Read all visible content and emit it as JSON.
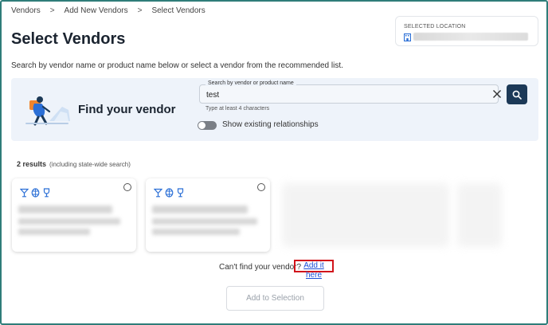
{
  "breadcrumb": {
    "items": [
      "Vendors",
      "Add New Vendors",
      "Select Vendors"
    ],
    "separator": ">"
  },
  "page": {
    "title": "Select Vendors",
    "instructions": "Search by vendor name or product name below or select a vendor from the recommended list."
  },
  "location": {
    "label": "SELECTED LOCATION",
    "icon": "building-icon"
  },
  "search_panel": {
    "title": "Find your vendor",
    "field_label": "Search by vendor or product name",
    "value": "test",
    "hint": "Type at least 4 characters",
    "toggle_label": "Show existing relationships",
    "toggle_on": false
  },
  "results": {
    "count_text": "2 results",
    "scope_text": "(including state-wide search)",
    "cards": [
      {
        "icons": [
          "cocktail-glass-icon",
          "beer-barrel-icon",
          "wine-glass-icon"
        ],
        "selected": false
      },
      {
        "icons": [
          "cocktail-glass-icon",
          "beer-barrel-icon",
          "wine-glass-icon"
        ],
        "selected": false
      }
    ]
  },
  "footer": {
    "cant_find_text": "Can't find your vendor?",
    "add_link_text": "Add it here",
    "add_button_label": "Add to Selection"
  },
  "colors": {
    "accent": "#1c3957",
    "icon_blue": "#2b6fd6",
    "highlight_red": "#d1141b",
    "panel_bg": "#eef3fa",
    "frame": "#2f7d79"
  }
}
